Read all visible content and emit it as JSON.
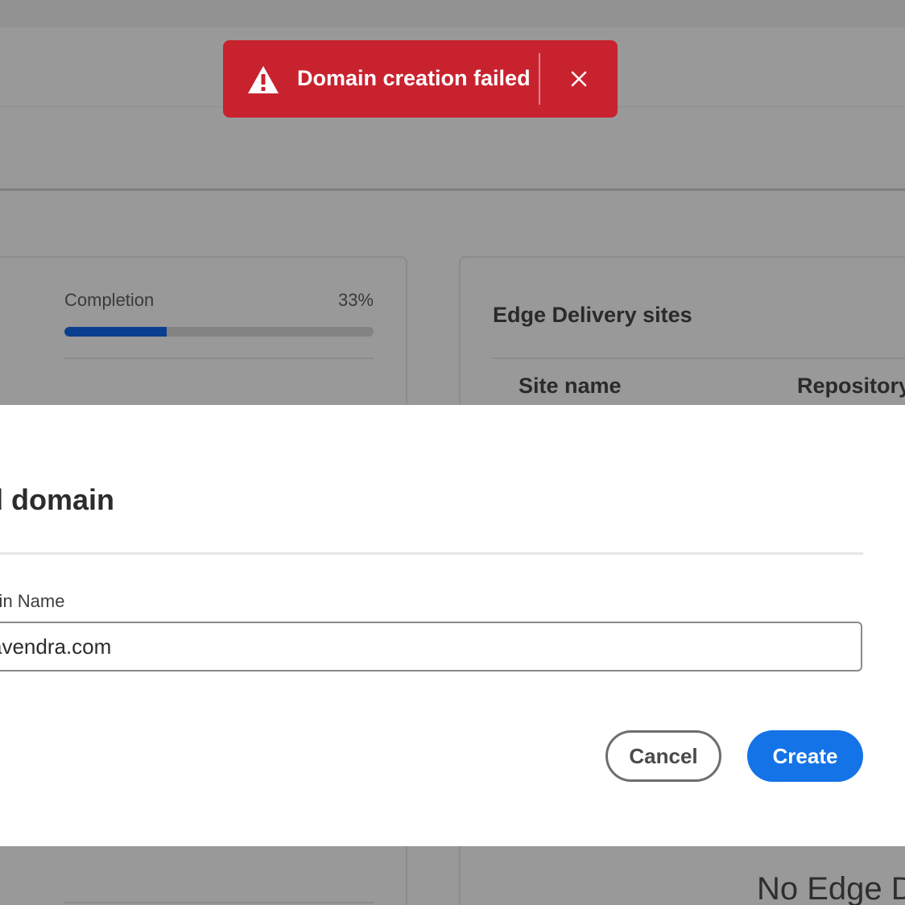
{
  "toast": {
    "message": "Domain creation failed",
    "icon": "alert-triangle-icon",
    "close_icon": "close-icon",
    "background": "#c9222f"
  },
  "background": {
    "completion": {
      "label": "Completion",
      "value_text": "33%",
      "progress_percent": 33,
      "fill_color": "#0a3f8f"
    },
    "edge_sites": {
      "title": "Edge Delivery sites",
      "columns": [
        "Site name",
        "Repository"
      ],
      "empty_text": "No Edge De"
    }
  },
  "dialog": {
    "title": "dd domain",
    "field_label": "main Name",
    "field_value": "avendra.com",
    "cancel_label": "Cancel",
    "create_label": "Create",
    "accent": "#1473e6"
  }
}
